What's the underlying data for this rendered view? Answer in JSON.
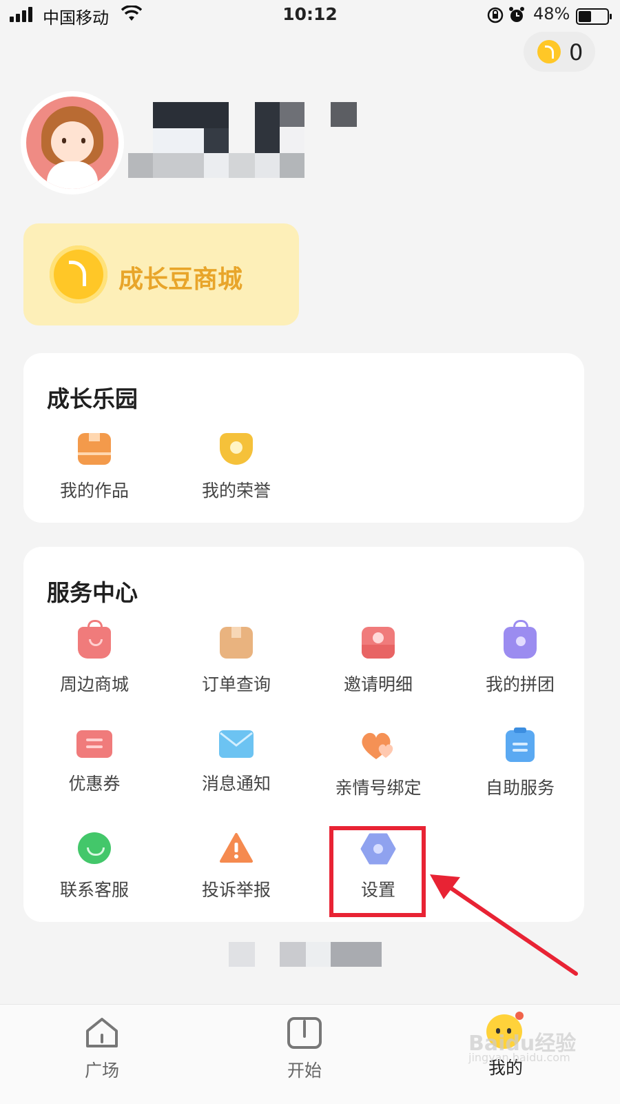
{
  "status_bar": {
    "carrier": "中国移动",
    "time": "10:12",
    "battery": "48%"
  },
  "coins": {
    "count": "0"
  },
  "shop_banner": {
    "label": "成长豆商城"
  },
  "growth_park": {
    "title": "成长乐园",
    "items": [
      {
        "label": "我的作品",
        "icon": "works-icon",
        "color": "#f39a4b"
      },
      {
        "label": "我的荣誉",
        "icon": "honor-icon",
        "color": "#f5c13a"
      }
    ]
  },
  "service_center": {
    "title": "服务中心",
    "items": [
      {
        "label": "周边商城",
        "icon": "shopping-bag-icon",
        "color": "#f07b7b"
      },
      {
        "label": "订单查询",
        "icon": "order-box-icon",
        "color": "#e9b37f"
      },
      {
        "label": "邀请明细",
        "icon": "invite-icon",
        "color": "#f07b7b"
      },
      {
        "label": "我的拼团",
        "icon": "group-buy-icon",
        "color": "#9b8cf0"
      },
      {
        "label": "优惠券",
        "icon": "coupon-icon",
        "color": "#f07b7b"
      },
      {
        "label": "消息通知",
        "icon": "mail-icon",
        "color": "#6cc3f2"
      },
      {
        "label": "亲情号绑定",
        "icon": "heart-icon",
        "color": "#f59155"
      },
      {
        "label": "自助服务",
        "icon": "clipboard-icon",
        "color": "#5aa9f2"
      },
      {
        "label": "联系客服",
        "icon": "chat-icon",
        "color": "#43c76a"
      },
      {
        "label": "投诉举报",
        "icon": "warning-icon",
        "color": "#f58a4f"
      },
      {
        "label": "设置",
        "icon": "gear-icon",
        "color": "#8fa2ef"
      }
    ]
  },
  "bottom_nav": [
    {
      "label": "广场",
      "icon": "home-icon"
    },
    {
      "label": "开始",
      "icon": "book-icon"
    },
    {
      "label": "我的",
      "icon": "profile-mascot-icon"
    }
  ],
  "watermark": {
    "main": "Baidu经验",
    "sub": "jingyan.baidu.com"
  }
}
